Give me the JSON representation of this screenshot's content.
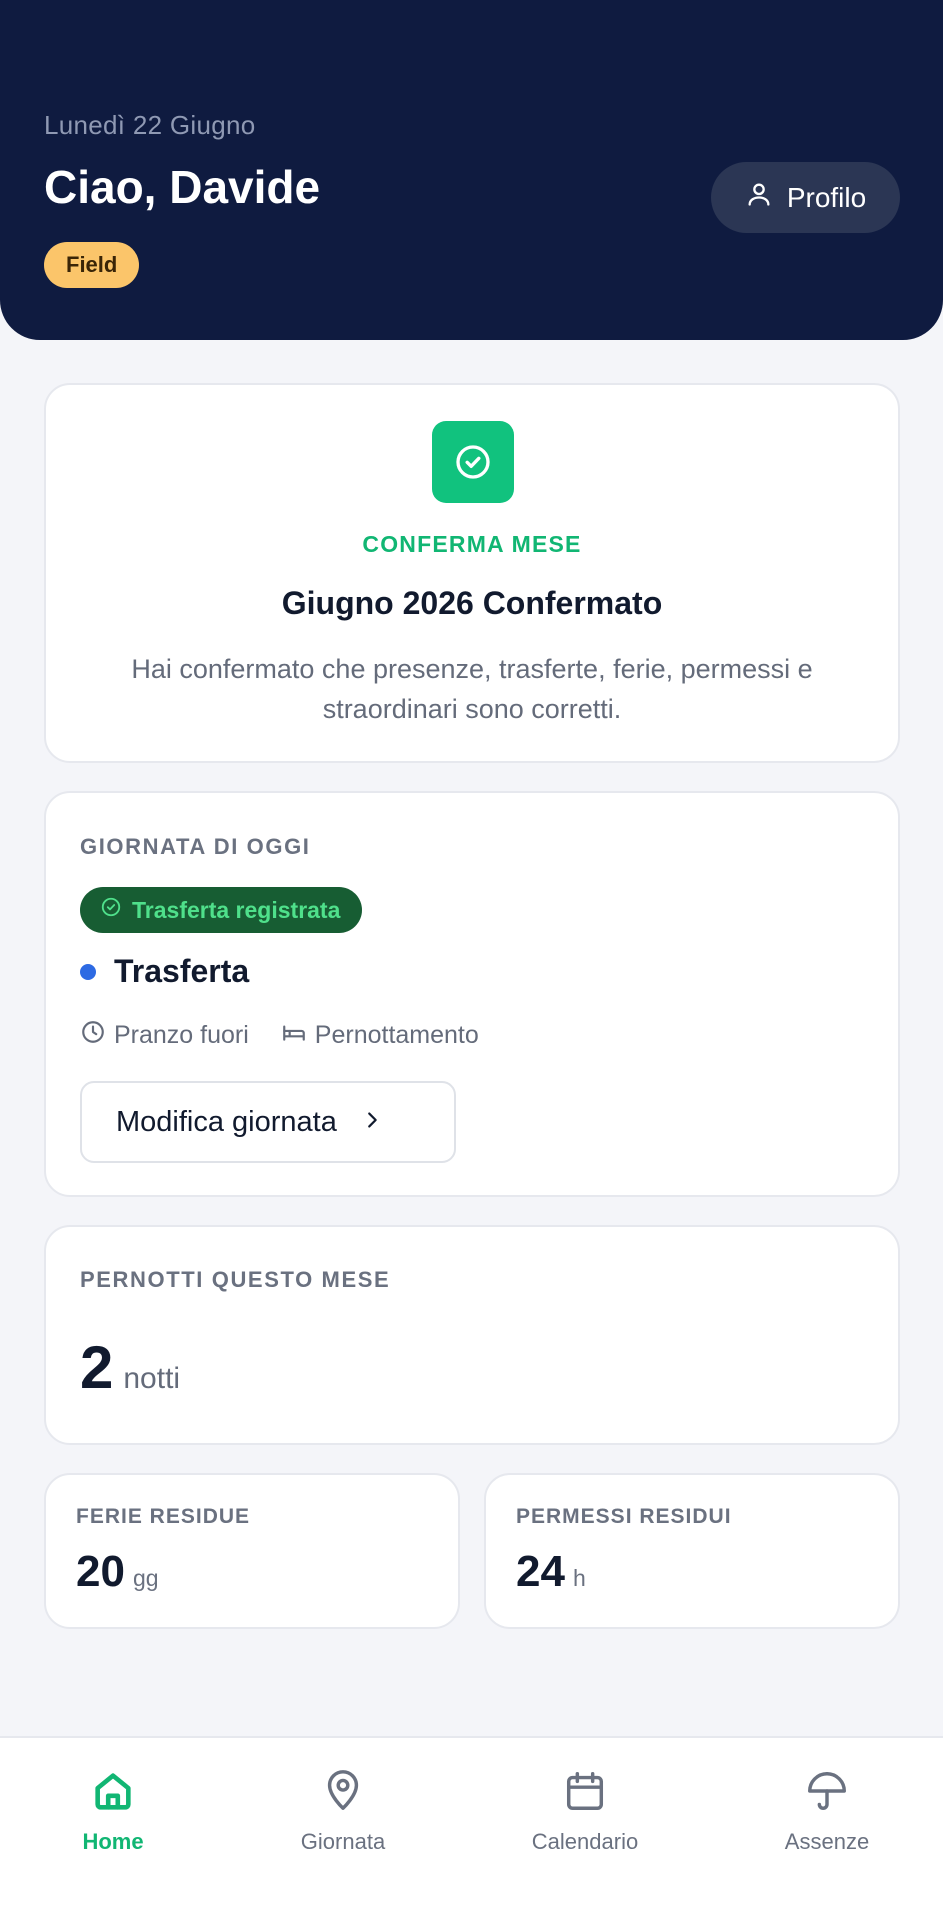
{
  "header": {
    "date": "Lunedì 22 Giugno",
    "greeting": "Ciao, Davide",
    "role_badge": "Field",
    "profile_label": "Profilo",
    "background_color": "#0f1b40"
  },
  "month_confirm": {
    "icon": "check-circle-icon",
    "eyebrow": "CONFERMA MESE",
    "title": "Giugno 2026 Confermato",
    "description": "Hai confermato che presenze, trasferte, ferie, permessi e straordinari sono corretti.",
    "accent_color": "#11c27e"
  },
  "today": {
    "section_label": "GIORNATA DI OGGI",
    "status_pill": "Trasferta registrata",
    "day_type": "Trasferta",
    "day_type_color": "#2d6ae3",
    "meta": [
      {
        "icon": "clock-icon",
        "label": "Pranzo fuori"
      },
      {
        "icon": "bed-icon",
        "label": "Pernottamento"
      }
    ],
    "edit_button": "Modifica giornata"
  },
  "nights": {
    "section_label": "PERNOTTI QUESTO MESE",
    "value": "2",
    "unit": "notti"
  },
  "balances": {
    "ferie": {
      "label": "FERIE RESIDUE",
      "value": "20",
      "unit": "gg"
    },
    "permessi": {
      "label": "PERMESSI RESIDUI",
      "value": "24",
      "unit": "h"
    }
  },
  "bottom_nav": {
    "active": "Home",
    "active_color": "#11b673",
    "items": [
      {
        "label": "Home",
        "icon": "home-icon"
      },
      {
        "label": "Giornata",
        "icon": "map-pin-icon"
      },
      {
        "label": "Calendario",
        "icon": "calendar-icon"
      },
      {
        "label": "Assenze",
        "icon": "umbrella-icon"
      }
    ]
  }
}
